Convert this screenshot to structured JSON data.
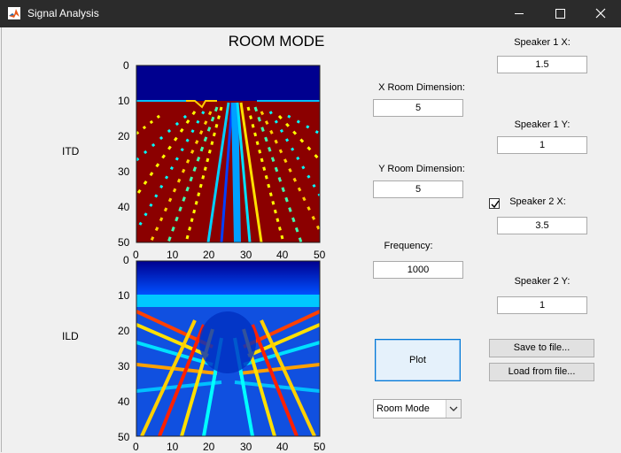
{
  "window": {
    "title": "Signal Analysis",
    "icon": "matlab-icon",
    "minimize_glyph": "—",
    "maximize_glyph": "☐",
    "close_glyph": "✕"
  },
  "figure": {
    "title": "ROOM MODE",
    "plots": [
      {
        "name": "itd-plot",
        "side_label": "ITD",
        "colormap": "jet",
        "x_ticks": [
          "0",
          "10",
          "20",
          "30",
          "40",
          "50"
        ],
        "y_ticks": [
          "0",
          "10",
          "20",
          "30",
          "40",
          "50"
        ]
      },
      {
        "name": "ild-plot",
        "side_label": "ILD",
        "colormap": "jet",
        "x_ticks": [
          "0",
          "10",
          "20",
          "30",
          "40",
          "50"
        ],
        "y_ticks": [
          "0",
          "10",
          "20",
          "30",
          "40",
          "50"
        ]
      }
    ]
  },
  "controls": {
    "x_room": {
      "label": "X Room Dimension:",
      "value": "5"
    },
    "y_room": {
      "label": "Y Room Dimension:",
      "value": "5"
    },
    "frequency": {
      "label": "Frequency:",
      "value": "1000"
    },
    "speaker1_x": {
      "label": "Speaker 1 X:",
      "value": "1.5"
    },
    "speaker1_y": {
      "label": "Speaker 1 Y:",
      "value": "1"
    },
    "speaker2_x": {
      "label": "Speaker 2 X:",
      "value": "3.5",
      "enabled": true
    },
    "speaker2_y": {
      "label": "Speaker 2 Y:",
      "value": "1"
    },
    "plot_button": "Plot",
    "save_button": "Save to file...",
    "load_button": "Load from file...",
    "mode_select": {
      "selected": "Room Mode"
    }
  },
  "colors": {
    "titlebar": "#2b2b2b",
    "panel": "#f0f0f0",
    "accent": "#0078d7"
  }
}
